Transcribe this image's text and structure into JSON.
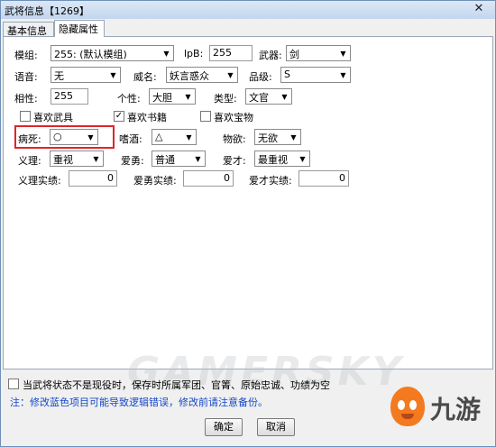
{
  "window": {
    "title": "武将信息【1269】",
    "close_glyph": "✕"
  },
  "tabs": [
    {
      "label": "基本信息",
      "active": false
    },
    {
      "label": "隐藏属性",
      "active": true
    }
  ],
  "form": {
    "model": {
      "label": "模组:",
      "value": "255: (默认模组)"
    },
    "lpb": {
      "label": "lpB:",
      "value": "255"
    },
    "weapon": {
      "label": "武器:",
      "value": "剑"
    },
    "voice": {
      "label": "语音:",
      "value": "无"
    },
    "fame": {
      "label": "威名:",
      "value": "妖言惑众"
    },
    "rank": {
      "label": "品级:",
      "value": "S"
    },
    "affinity": {
      "label": "相性:",
      "value": "255"
    },
    "personality": {
      "label": "个性:",
      "value": "大胆"
    },
    "type": {
      "label": "类型:",
      "value": "文官"
    },
    "likes_weapon": {
      "label": "喜欢武具",
      "checked": false
    },
    "likes_books": {
      "label": "喜欢书籍",
      "checked": true
    },
    "likes_treasure": {
      "label": "喜欢宝物",
      "checked": false
    },
    "disease": {
      "label": "病死:",
      "value": "○"
    },
    "alcohol": {
      "label": "嗜酒:",
      "value": "△"
    },
    "desire": {
      "label": "物欲:",
      "value": "无欲"
    },
    "righteous": {
      "label": "义理:",
      "value": "重视"
    },
    "brave": {
      "label": "爱勇:",
      "value": "普通"
    },
    "talent": {
      "label": "爱才:",
      "value": "最重视"
    },
    "righteous_actual": {
      "label": "义理实绩:",
      "value": "0"
    },
    "brave_actual": {
      "label": "爱勇实绩:",
      "value": "0"
    },
    "talent_actual": {
      "label": "爱才实绩:",
      "value": "0"
    }
  },
  "footer": {
    "status_check_label": "当武将状态不是现役时，保存时所属军团、官箐、原始忠诚、功绩为空",
    "notice": "注：修改蓝色项目可能导致逻辑错误，修改前请注意备份。",
    "ok_label": "确定",
    "cancel_label": "取消"
  },
  "watermark": "GAMERSKY",
  "brand": "九游",
  "colors": {
    "highlight": "#e2232a",
    "notice": "#1447c8",
    "brand_orange": "#f47a1f"
  }
}
